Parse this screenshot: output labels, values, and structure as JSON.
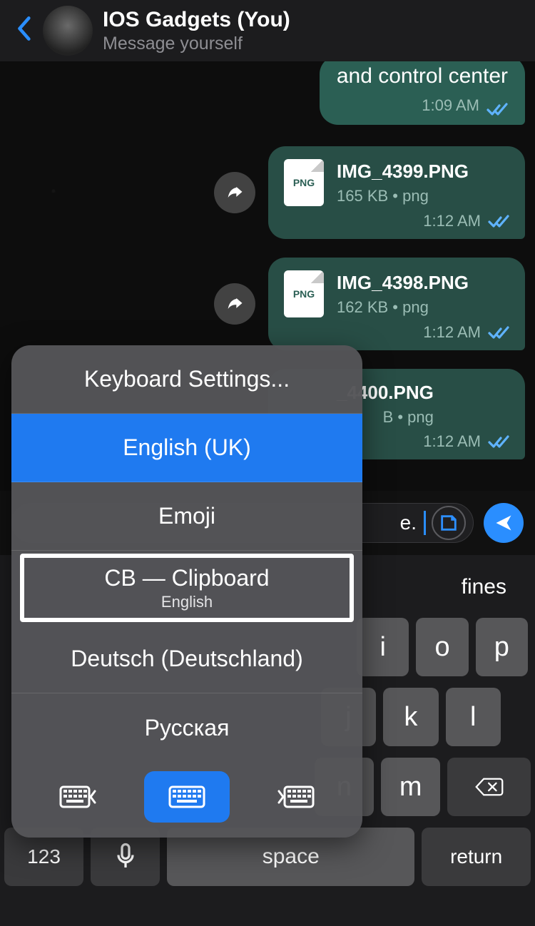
{
  "header": {
    "title": "IOS Gadgets (You)",
    "subtitle": "Message yourself"
  },
  "messages": {
    "top_text_fragment": "and control center",
    "top_time": "1:09 AM",
    "file1": {
      "name": "IMG_4399.PNG",
      "meta": "165 KB • png",
      "time": "1:12 AM",
      "badge": "PNG"
    },
    "file2": {
      "name": "IMG_4398.PNG",
      "meta": "162 KB • png",
      "time": "1:12 AM",
      "badge": "PNG"
    },
    "file3": {
      "name_partial": "_4400.PNG",
      "meta_partial": "B • png",
      "time": "1:12 AM"
    }
  },
  "input": {
    "typed_visible": "e."
  },
  "popover": {
    "settings": "Keyboard Settings...",
    "english_uk": "English (UK)",
    "emoji": "Emoji",
    "clipboard_title": "CB — Clipboard",
    "clipboard_sub": "English",
    "deutsch": "Deutsch (Deutschland)",
    "russian": "Русская"
  },
  "suggestions": {
    "right": "fines"
  },
  "keys": {
    "row2_visible": [
      "i",
      "o",
      "p"
    ],
    "row3_visible": [
      "j",
      "k",
      "l"
    ],
    "row4_visible": [
      "n",
      "m"
    ],
    "num": "123",
    "space": "space",
    "return": "return"
  }
}
